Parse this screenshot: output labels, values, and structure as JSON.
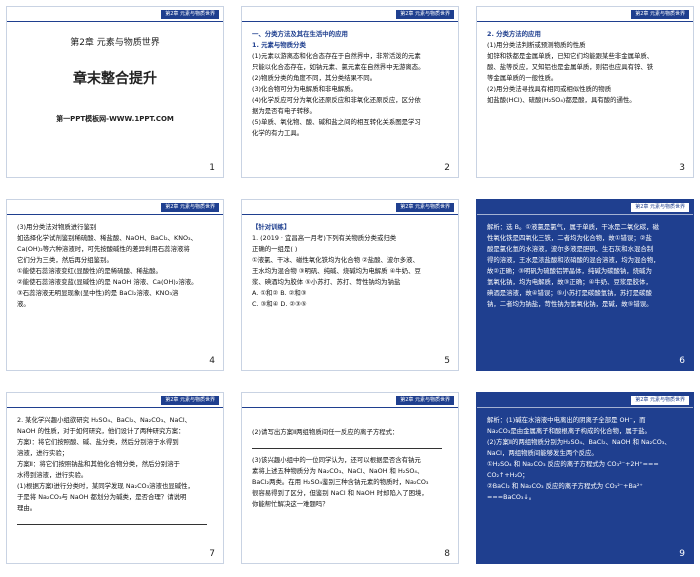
{
  "header_label": "第2章 元素与物质世界",
  "slides": [
    {
      "id": 1,
      "number": "1",
      "chapter": "第2章 元素与物质世界",
      "title": "章末整合提升",
      "brand": "第一PPT模板网-WWW.1PPT.COM"
    },
    {
      "id": 2,
      "number": "2",
      "lines": [
        "一、分类方法及其在生活中的应用",
        "1. 元素与物质分类",
        "(1)元素以游离态和化合态存在于自然界中，非常活泼的元素",
        "只能以化合态存在，如钠元素、氯元素在自然界中无游离态。",
        "(2)物质分类的角度不同，其分类结果不同。",
        "(3)化合物可分为电解质和非电解质。",
        "(4)化学反应可分为氧化还原反应和非氧化还原反应，区分依",
        "据为是否有电子转移。",
        "(5)单质、氧化物、酸、碱和盐之间的相互转化关系图是学习",
        "化学的有力工具。"
      ]
    },
    {
      "id": 3,
      "number": "3",
      "lines": [
        "2. 分类方法的应用",
        "(1)用分类法判断或预测物质的性质",
        "如锌和铁都是金属单质，已知它们均能跟某些非金属单质、",
        "酸、盐等反应，又知铝也是金属单质，则铝也应具有锌、铁",
        "等金属单质的一般性质。",
        "(2)用分类法寻找具有相同或相似性质的物质",
        "如盐酸(HCl)、硫酸(H₂SO₄)都是酸，具有酸的通性。"
      ]
    },
    {
      "id": 4,
      "number": "4",
      "lines": [
        "(3)用分类法对物质进行鉴别",
        "如选择化学试剂鉴别稀硫酸、稀盐酸、NaOH、BaCl₂、KNO₃、",
        "Ca(OH)₂等六种溶液时，可先按酸碱性的差异利用石蕊溶液将",
        "它们分为三类，然后再分组鉴别。",
        "①能使石蕊溶液变红(显酸性)的是稀硫酸、稀盐酸。",
        "②能使石蕊溶液变蓝(显碱性)的是 NaOH 溶液、Ca(OH)₂溶液。",
        "③石蕊溶液无明显现象(显中性)的是 BaCl₂溶液、KNO₃溶",
        "液。"
      ]
    },
    {
      "id": 5,
      "number": "5",
      "lines": [
        "【针对训练】",
        "1. (2019 · 宜昌高一月考)下列有关物质分类或归类",
        "正确的一组是(     )",
        "①液氯、干冰、磁性氧化铁均为化合物  ②盐酸、波尔多液、",
        "王水均为混合物  ③明矾、纯碱、烧碱均为电解质  ④牛奶、豆",
        "浆、碘酒均为胶体  ⑤小苏打、苏打、苛性钠均为钠盐",
        "A. ①和②                    B. ②和③",
        "C. ③和④                    D. ②③⑤"
      ]
    },
    {
      "id": 6,
      "number": "6",
      "lines": [
        "解析：选 B。①液氯是氯气，属于单质，干冰是二氧化碳，磁",
        "性氧化铁是四氧化三铁，二者均为化合物，故①错误；②盐",
        "酸是氯化氢的水溶液，波尔多液是胆矾、生石灰和水混合制",
        "得的溶液，王水是浓盐酸和浓硝酸的混合溶液，均为混合物，",
        "故②正确；③明矾为硫酸铝钾晶体，纯碱为碳酸钠，烧碱为",
        "氢氧化钠，均为电解质，故③正确；④牛奶、豆浆是胶体，",
        "碘酒是溶液，故④错误；⑤小苏打是碳酸氢钠，苏打是碳酸",
        "钠，二者均为钠盐，苛性钠为氢氧化钠，是碱，故⑤错误。"
      ]
    },
    {
      "id": 7,
      "number": "7",
      "lines": [
        "2. 某化学兴趣小组欲研究 H₂SO₄、BaCl₂、Na₂CO₃、NaCl、",
        "NaOH 的性质，对于如何研究，他们设计了两种研究方案：",
        "方案Ⅰ：将它们按照酸、碱、盐分类，然后分别溶于水得到",
        "溶液，进行实验；",
        "方案Ⅱ：将它们按照钠盐和其他化合物分类，然后分别溶于",
        "水得到溶液，进行实验。",
        "(1)根据方案Ⅰ进行分类时，某同学发现 Na₂CO₃溶液也显碱性，",
        "于是将 Na₂CO₃与 NaOH 都划分为碱类，是否合理？请说明",
        "理由。"
      ]
    },
    {
      "id": 8,
      "number": "8",
      "lines": [
        "(2)请写出方案Ⅱ两组物质间任一反应的离子方程式：",
        "(3)该兴趣小组中的一位同学认为，还可以根据是否含有钠元",
        "素将上述五种物质分为 Na₂CO₃、NaCl、NaOH 和 H₂SO₄、",
        "BaCl₂两类。在用 H₂SO₄鉴别三种含钠元素的物质时，Na₂CO₃",
        "很容易得到了区分，但鉴别 NaCl 和 NaOH 时却陷入了困境，",
        "你能帮忙解决这一难题吗？"
      ]
    },
    {
      "id": 9,
      "number": "9",
      "lines": [
        "解析：(1)碱在水溶液中电离出的阴离子全部是 OH⁻，而",
        "Na₂CO₃是由金属离子和酸根离子构成的化合物，属于盐。",
        "(2)方案Ⅱ的两组物质分别为H₂SO₄、BaCl₂、NaOH 和 Na₂CO₃、",
        "NaCl，两组物质间能够发生两个反应。",
        "①H₂SO₄ 和 Na₂CO₃ 反应的离子方程式为 CO₃²⁻+2H⁺===",
        "CO₂↑+H₂O；",
        "②BaCl₂ 和 Na₂CO₃ 反应的离子方程式为 CO₃²⁻+Ba²⁺",
        "===BaCO₃↓。"
      ]
    }
  ]
}
